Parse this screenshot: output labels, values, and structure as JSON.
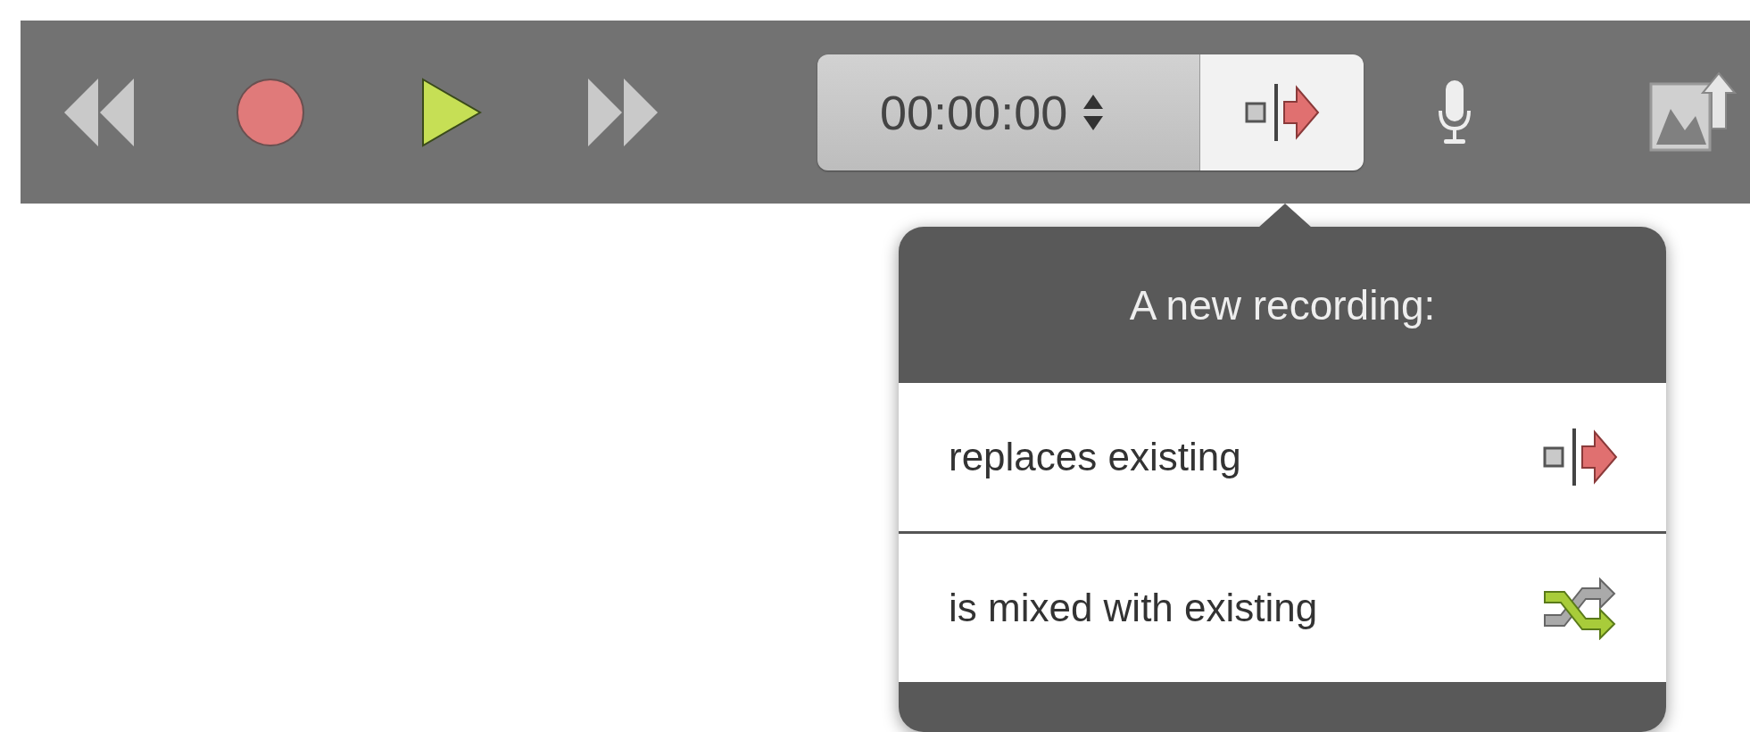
{
  "toolbar": {
    "time": "00:00:00"
  },
  "popover": {
    "title": "A new recording:",
    "options": [
      {
        "label": "replaces existing",
        "kind": "replace"
      },
      {
        "label": "is mixed with existing",
        "kind": "mix"
      }
    ]
  }
}
